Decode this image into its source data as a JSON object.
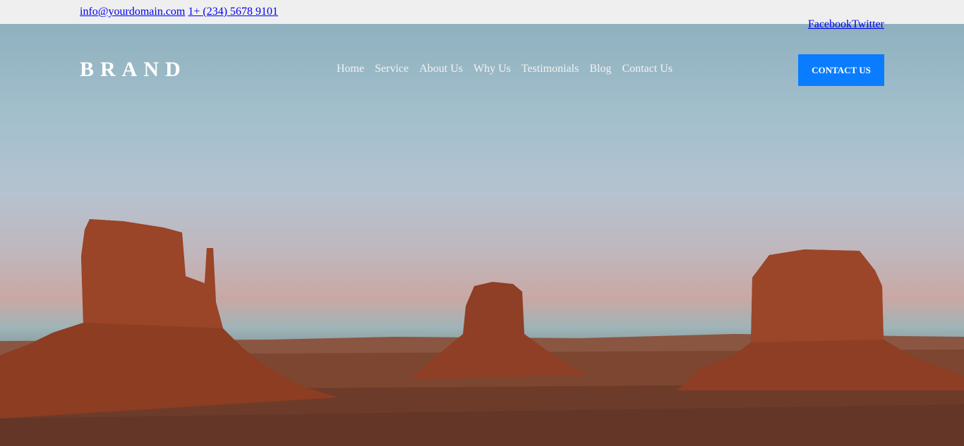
{
  "topbar": {
    "email": "info@yourdomain.com",
    "phone": "1+ (234) 5678 9101",
    "social": [
      "Facebook",
      "Twitter"
    ]
  },
  "header": {
    "brand": "BRAND",
    "menu": [
      "Home",
      "Service",
      "About Us",
      "Why Us",
      "Testimonials",
      "Blog",
      "Contact Us"
    ],
    "cta_label": "CONTACT US"
  },
  "colors": {
    "cta_bg": "#0a7cff",
    "topbar_bg": "#efefef"
  }
}
